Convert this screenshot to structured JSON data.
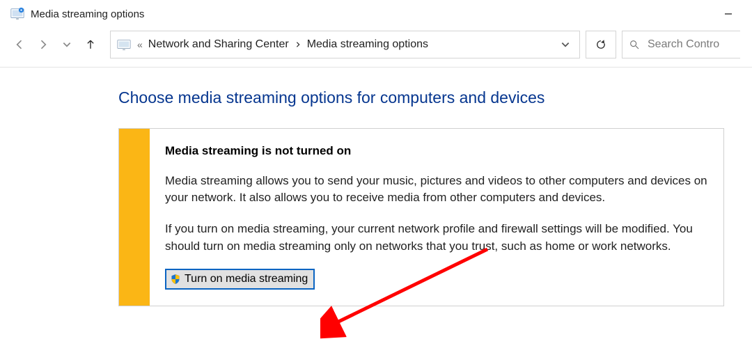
{
  "window": {
    "title": "Media streaming options"
  },
  "nav": {
    "breadcrumb_prefix": "«",
    "segments": [
      "Network and Sharing Center",
      "Media streaming options"
    ]
  },
  "search": {
    "placeholder": "Search Contro"
  },
  "main": {
    "heading": "Choose media streaming options for computers and devices",
    "panel": {
      "title": "Media streaming is not turned on",
      "para1": "Media streaming allows you to send your music, pictures and videos to other computers and devices on your network.  It also allows you to receive media from other computers and devices.",
      "para2": "If you turn on media streaming, your current network profile and firewall settings will be modified. You should turn on media streaming only on networks that you trust, such as home or work networks.",
      "button_label": "Turn on media streaming"
    }
  },
  "colors": {
    "heading": "#06368f",
    "accent_strip": "#fbb615",
    "button_border": "#0a64c2",
    "annotation": "#ff0000"
  }
}
